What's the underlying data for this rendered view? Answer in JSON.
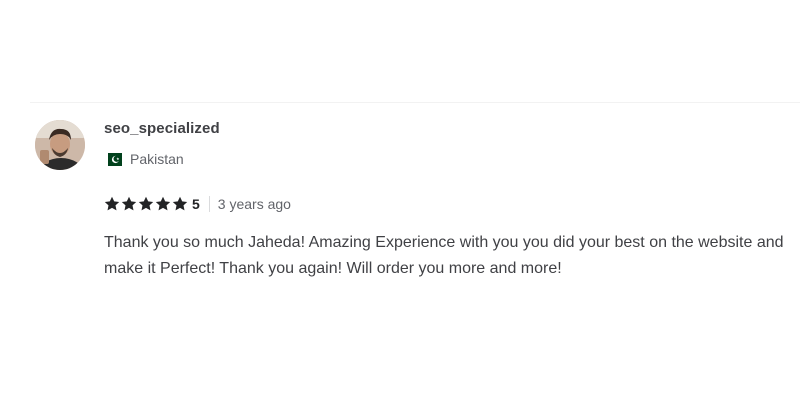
{
  "review": {
    "username": "seo_specialized",
    "country": {
      "name": "Pakistan",
      "flag_icon": "pakistan-flag-icon"
    },
    "rating": {
      "stars": 5,
      "value": "5",
      "star_color": "#222325"
    },
    "time": "3 years ago",
    "text": "Thank you so much Jaheda! Amazing Experience with you you did your best on the website and make it Perfect! Thank you again! Will order you more and more!"
  },
  "colors": {
    "text_primary": "#404145",
    "text_secondary": "#62646a",
    "flag_green": "#01411c"
  }
}
